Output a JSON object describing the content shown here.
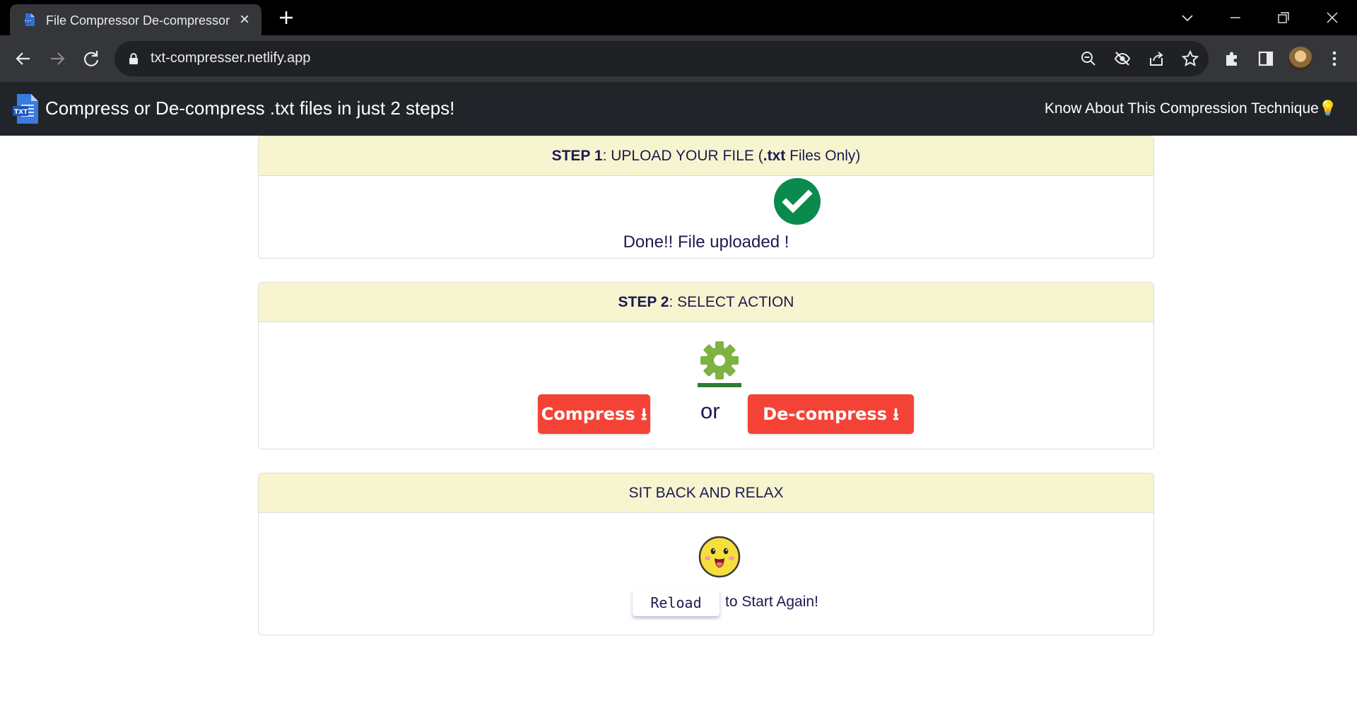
{
  "browser": {
    "tab_title": "File Compressor De-compressor",
    "url": "txt-compresser.netlify.app"
  },
  "navbar": {
    "brand_text": "Compress or De-compress .txt files in just 2 steps!",
    "link_text": "Know About This Compression Technique💡"
  },
  "step1": {
    "header_bold": "STEP 1",
    "header_text_a": ": UPLOAD YOUR FILE (",
    "header_bold_ext": ".txt",
    "header_text_b": " Files Only)",
    "status": "Done!! File uploaded !"
  },
  "step2": {
    "header_bold": "STEP 2",
    "header_text": ": SELECT ACTION",
    "compress_label": "Compress ⭳",
    "or_text": "or",
    "decompress_label": "De-compress ⭳"
  },
  "step3": {
    "header_text": "SIT BACK AND RELAX",
    "reload_label": "Reload",
    "after_text": "to Start Again!"
  },
  "colors": {
    "navbar": "#212529",
    "card_header": "#f7f5d0",
    "action_button": "#f44336",
    "success": "#0a8a4c",
    "gear": "#7cb342",
    "text": "#1c1a4f"
  }
}
